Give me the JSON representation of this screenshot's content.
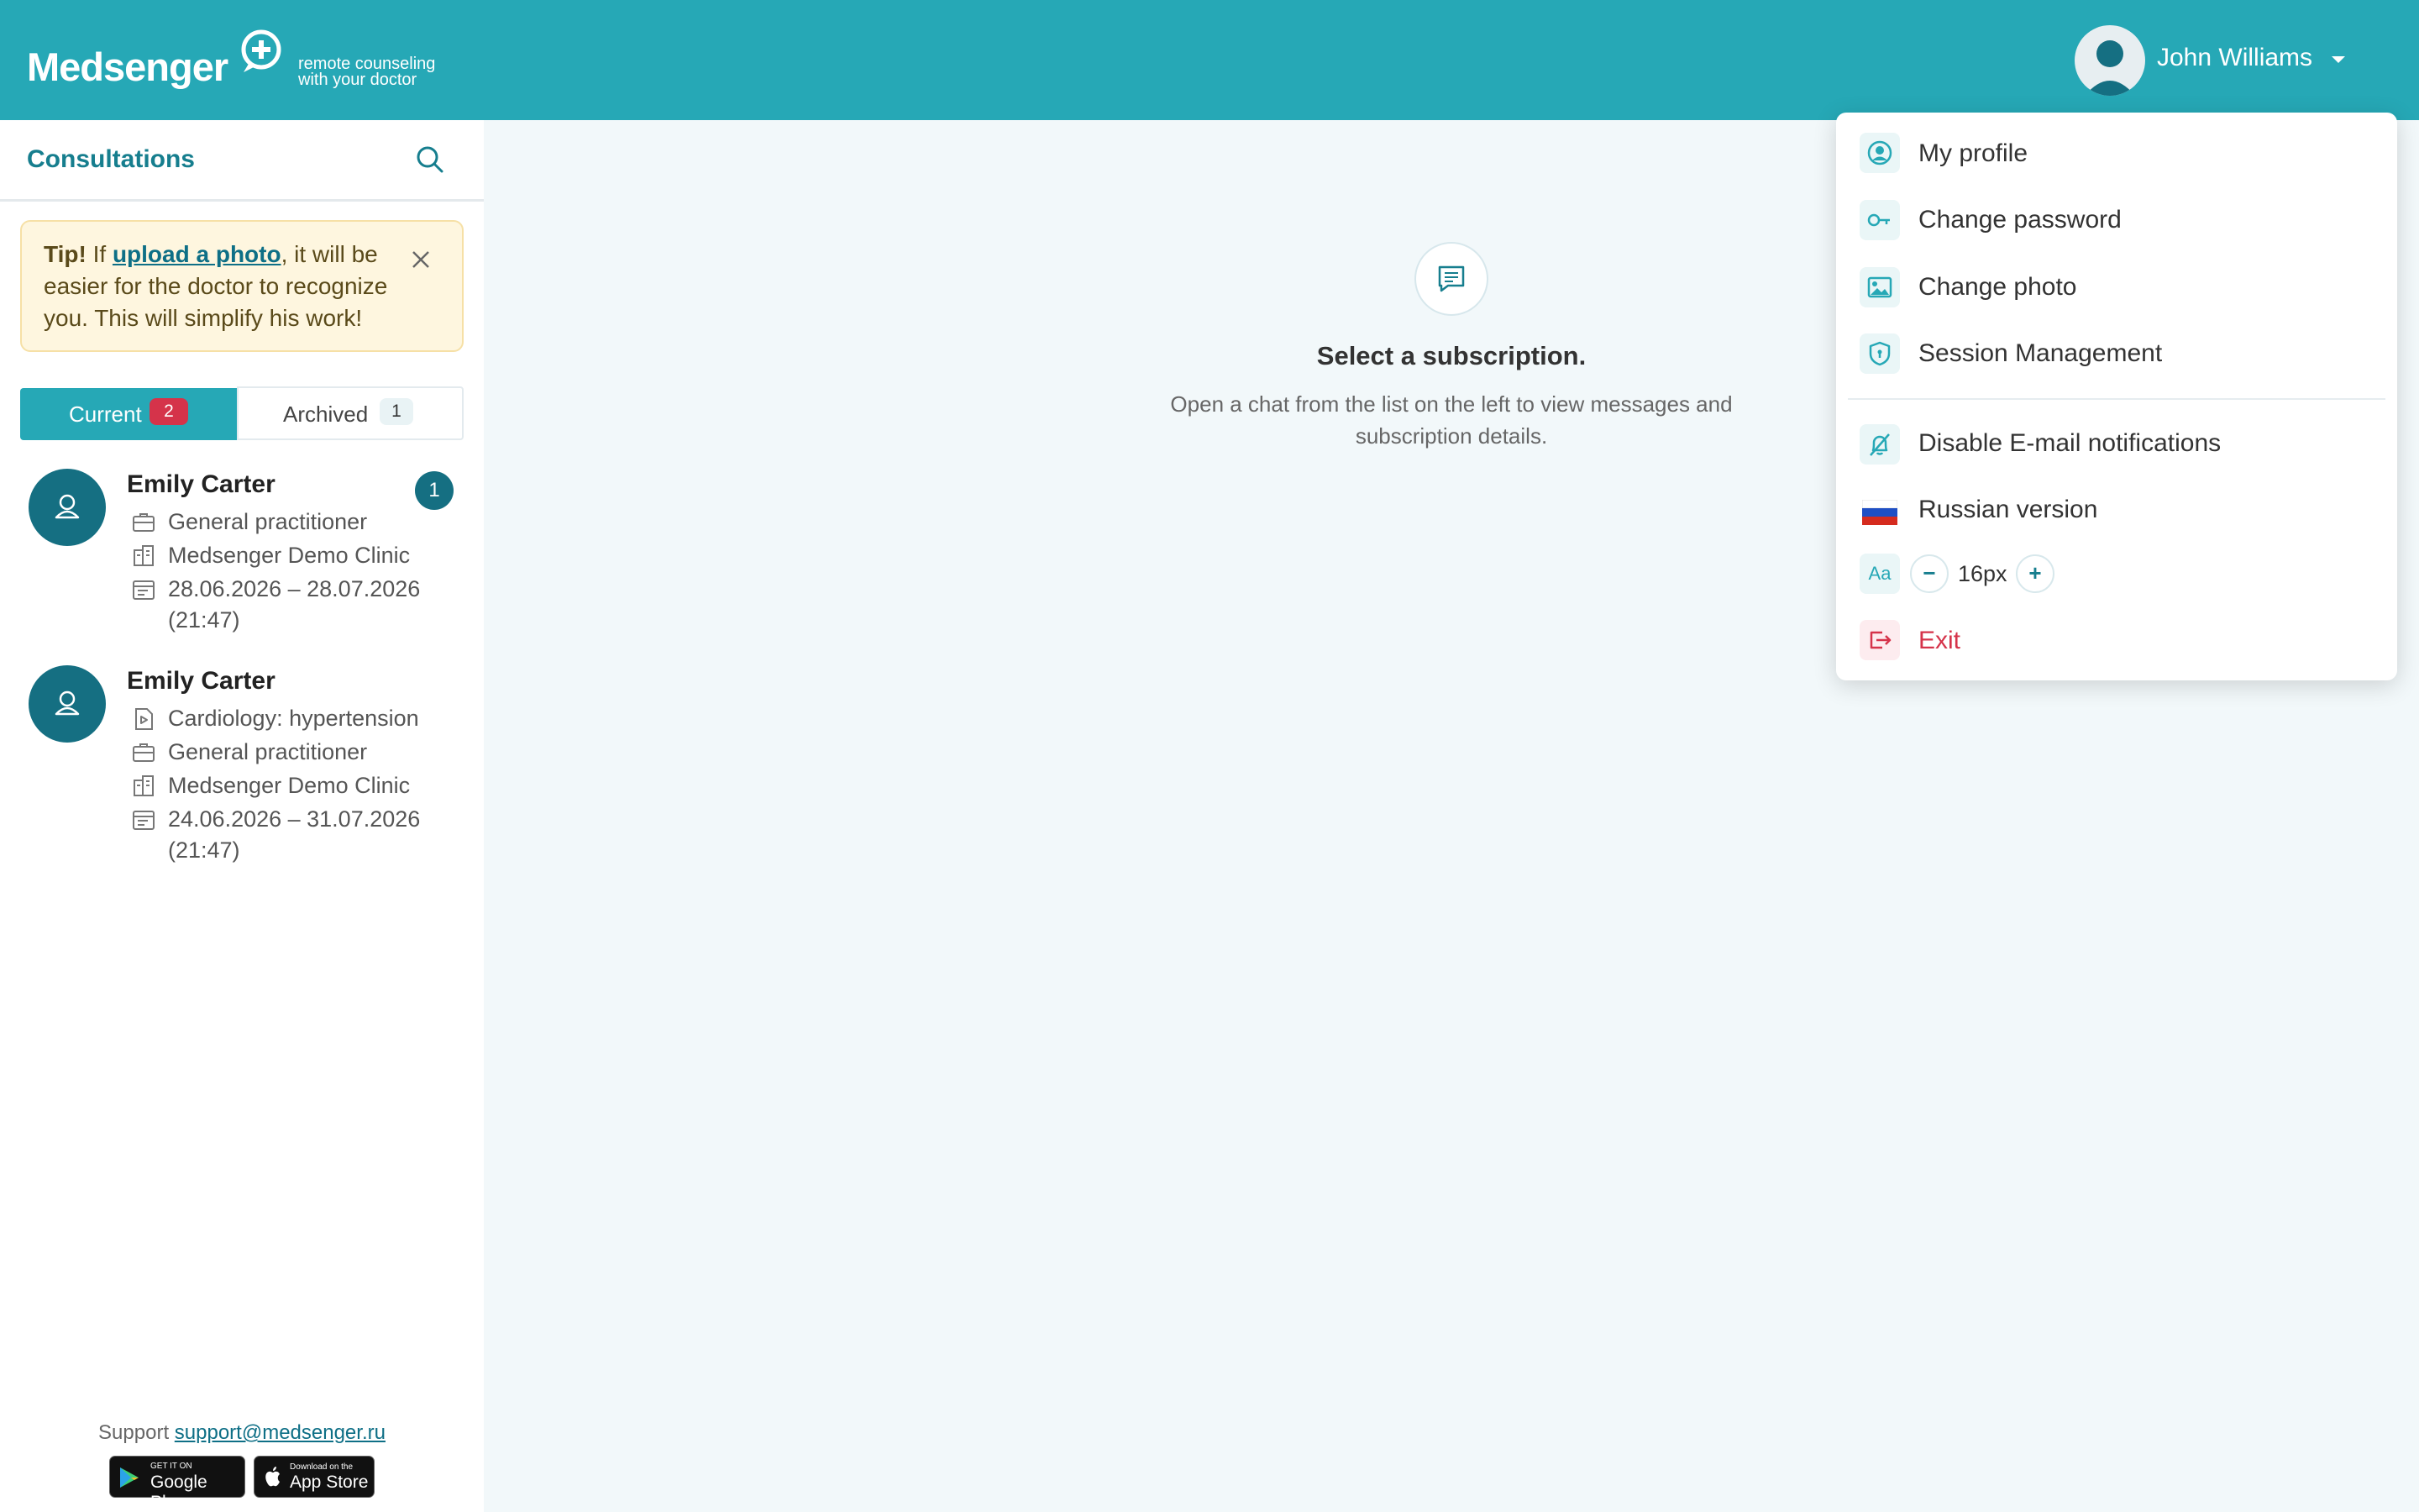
{
  "header": {
    "logo_med": "Med",
    "logo_senger": "senger",
    "logo_tagline_1": "remote counseling",
    "logo_tagline_2": "with your doctor",
    "user_name": "John Williams"
  },
  "sidebar": {
    "title": "Consultations",
    "tip": {
      "strong": "Tip!",
      "prefix": " If ",
      "link": "upload a photo",
      "suffix": ", it will be easier for the doctor to recognize you. This will simplify his work!"
    },
    "tabs": [
      {
        "label": "Current",
        "count": "2"
      },
      {
        "label": "Archived",
        "count": "1"
      }
    ],
    "consultations": [
      {
        "name": "Emily Carter",
        "unread": "1",
        "lines": [
          {
            "icon": "briefcase-icon",
            "text": "General practitioner"
          },
          {
            "icon": "clinic-icon",
            "text": "Medsenger Demo Clinic"
          },
          {
            "icon": "calendar-icon",
            "text": "28.06.2026 – 28.07.2026"
          },
          {
            "icon": "",
            "text": "(21:47)"
          }
        ]
      },
      {
        "name": "Emily Carter",
        "unread": "",
        "lines": [
          {
            "icon": "document-play-icon",
            "text": "Cardiology: hypertension"
          },
          {
            "icon": "briefcase-icon",
            "text": "General practitioner"
          },
          {
            "icon": "clinic-icon",
            "text": "Medsenger Demo Clinic"
          },
          {
            "icon": "calendar-icon",
            "text": "24.06.2026 – 31.07.2026"
          },
          {
            "icon": "",
            "text": "(21:47)"
          }
        ]
      }
    ],
    "support_label": "Support",
    "support_email": "support@medsenger.ru",
    "google_play_small": "GET IT ON",
    "google_play_big": "Google Play",
    "app_store_small": "Download on the",
    "app_store_big": "App Store"
  },
  "main": {
    "empty_title": "Select a subscription.",
    "empty_subtitle": "Open a chat from the list on the left to view messages and subscription details."
  },
  "menu": {
    "items": [
      {
        "label": "My profile",
        "icon": "user-circle-icon"
      },
      {
        "label": "Change password",
        "icon": "key-icon"
      },
      {
        "label": "Change photo",
        "icon": "image-icon"
      },
      {
        "label": "Session Management",
        "icon": "shield-icon"
      },
      {
        "label": "Disable E-mail notifications",
        "icon": "bell-off-icon"
      },
      {
        "label": "Russian version",
        "icon": "russian-flag-icon"
      }
    ],
    "font_size_icon_text": "Aa",
    "font_minus": "−",
    "font_size_value": "16px",
    "font_plus": "+",
    "exit_label": "Exit"
  },
  "colors": {
    "header": "#26a8b6",
    "accent_dark": "#156f82",
    "badge_red": "#d5334a",
    "exit_red": "#d5334a"
  }
}
